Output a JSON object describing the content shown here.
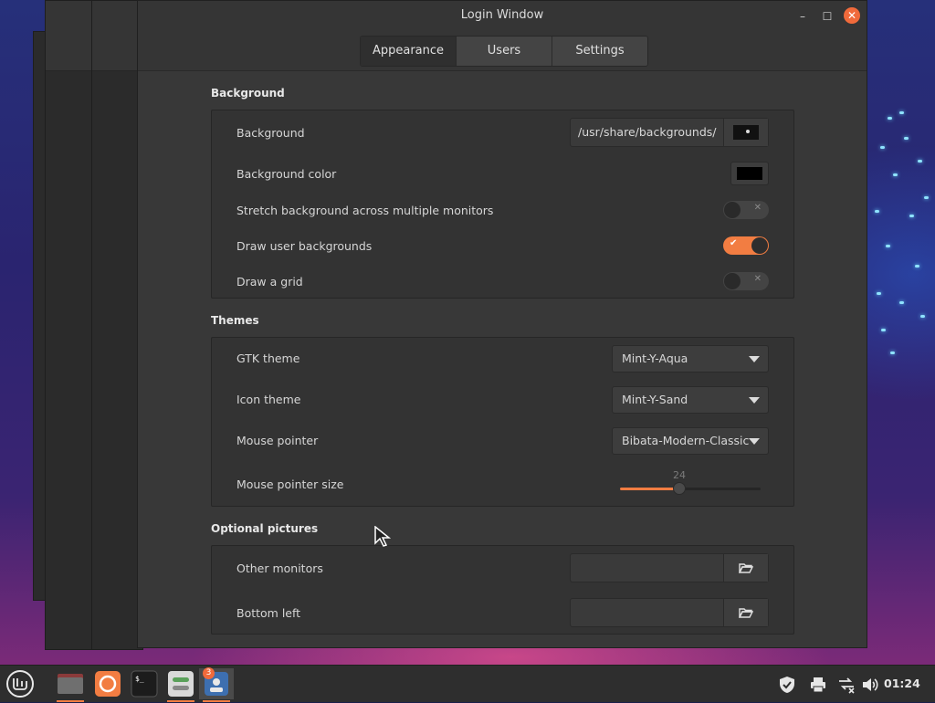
{
  "window": {
    "title": "Login Window",
    "controls": {
      "minimize": "–",
      "maximize": "☐",
      "close": "✕"
    }
  },
  "tabs": [
    {
      "label": "Appearance",
      "active": true
    },
    {
      "label": "Users",
      "active": false
    },
    {
      "label": "Settings",
      "active": false
    }
  ],
  "background_section": {
    "title": "Background",
    "background": {
      "label": "Background",
      "path": "/usr/share/backgrounds/"
    },
    "background_color": {
      "label": "Background color",
      "color": "#000000"
    },
    "stretch": {
      "label": "Stretch background across multiple monitors",
      "on": false
    },
    "draw_user_backgrounds": {
      "label": "Draw user backgrounds",
      "on": true
    },
    "draw_grid": {
      "label": "Draw a grid",
      "on": false
    }
  },
  "themes_section": {
    "title": "Themes",
    "gtk_theme": {
      "label": "GTK theme",
      "value": "Mint-Y-Aqua"
    },
    "icon_theme": {
      "label": "Icon theme",
      "value": "Mint-Y-Sand"
    },
    "mouse_pointer": {
      "label": "Mouse pointer",
      "value": "Bibata-Modern-Classic"
    },
    "mouse_pointer_size": {
      "label": "Mouse pointer size",
      "value": "24",
      "fraction": 0.42
    }
  },
  "optional_pictures_section": {
    "title": "Optional pictures",
    "other_monitors": {
      "label": "Other monitors",
      "value": ""
    },
    "bottom_left": {
      "label": "Bottom left",
      "value": ""
    }
  },
  "taskbar": {
    "apps": [
      "menu-icon",
      "files-icon",
      "firefox-icon",
      "terminal-icon",
      "settings-icon",
      "login-window-icon"
    ],
    "badge": "3",
    "clock": "01:24"
  },
  "colors": {
    "accent": "#f27d42",
    "close": "#f06a3b"
  }
}
